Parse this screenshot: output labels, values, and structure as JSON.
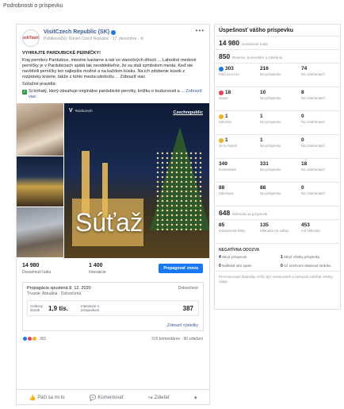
{
  "page": {
    "title": "Podrobnosti o príspevku"
  },
  "post": {
    "avatar_text": "CzechTourism",
    "page_name": "VisitCzech Republic (SK)",
    "meta": "Publikoval(a): Daniel Czech Republic · 17. decembra · ⚙",
    "more": "•••",
    "heading": "VYHRAJTE PARDUBICKÉ PERNÍČKY!",
    "body": "Kraj pernikov Pardubice, miestne kaviarne a tak vo vianočných dňoch ... Lahodné medové perníčky je v Pardubiciach spätá tak neoddeliteľne, že sa stali symbolom mesta. Keď ste navštívili perníčky len najlepšie možné a na každom kúsku. Na ich zdobenie kúsok z rozprávky krásne, takže z tohto mesta udobrotu ... Zobraziť viac",
    "see_more": "Zobraziť viac",
    "rules_label": "Súťažné pravidlá:",
    "contest_text": "Si bohatý, ktorý obsahuje originálne pardubické perníky, knižku o buducnosti a ...",
    "contest_link": "Zobraziť viac",
    "media": {
      "logo_text": "V",
      "logo_sub": "#visitczech",
      "brand_right": "Czechrepublic",
      "overlay": "Súťaž"
    },
    "stats": [
      {
        "value": "14 980",
        "label": "Dosiahnutí ľudia"
      },
      {
        "value": "1 400",
        "label": "Interakcie"
      }
    ],
    "boost_label": "Propagovať znova",
    "ad": {
      "title": "Propagácia spustená 8. 12. 2020",
      "subtitle": "Trvanie: Aktuálna · Dokončená",
      "status": "Dokončené",
      "metrics": [
        {
          "label": "Celkový dosah",
          "value": "1,9 tis."
        },
        {
          "label": "Interakcie s príspevkom",
          "value": "387"
        }
      ],
      "link": "Zobraziť výsledky"
    },
    "reactions": {
      "count": "301",
      "comments": "315 komentárov · 90 zdieľaní"
    },
    "actions": [
      {
        "icon": "👍",
        "label": "Páči sa mi to"
      },
      {
        "icon": "💬",
        "label": "Komentovať"
      },
      {
        "icon": "↪",
        "label": "Zdieľať"
      },
      {
        "icon": "▾",
        "label": ""
      }
    ]
  },
  "performance": {
    "title": "Úspešnosť vášho príspevku",
    "reach": {
      "value": "14 980",
      "label": "Dosiahnutí ľudia"
    },
    "engagement": {
      "value": "850",
      "label": "Reakcie, komentáre a zdieľania"
    },
    "reaction_rows": [
      [
        {
          "value": "303",
          "label": "Páči sa mi to",
          "emoji": "like"
        },
        {
          "value": "216",
          "label": "Na príspevku"
        },
        {
          "value": "74",
          "label": "Na zdieľaniach"
        }
      ],
      [
        {
          "value": "18",
          "label": "Super",
          "emoji": "love"
        },
        {
          "value": "10",
          "label": "Na príspevku"
        },
        {
          "value": "8",
          "label": "Na zdieľaniach"
        }
      ],
      [
        {
          "value": "1",
          "label": "Zdvorilo",
          "emoji": "wow"
        },
        {
          "value": "1",
          "label": "Na príspevku"
        },
        {
          "value": "0",
          "label": "Na zdieľaniach"
        }
      ],
      [
        {
          "value": "1",
          "label": "Je to vtipné",
          "emoji": "wow"
        },
        {
          "value": "1",
          "label": "Na príspevku"
        },
        {
          "value": "0",
          "label": "Na zdieľaniach"
        }
      ],
      [
        {
          "value": "349",
          "label": "Komentáre"
        },
        {
          "value": "331",
          "label": "Na príspevku"
        },
        {
          "value": "18",
          "label": "Na zdieľaniach"
        }
      ],
      [
        {
          "value": "88",
          "label": "Zdieľania"
        },
        {
          "value": "88",
          "label": "Na príspevku"
        },
        {
          "value": "0",
          "label": "Na zdieľaniach"
        }
      ]
    ],
    "clicks": {
      "value": "648",
      "label": "Kliknutia na príspevok"
    },
    "click_row": [
      {
        "value": "85",
        "label": "Zobrazenia fotky"
      },
      {
        "value": "135",
        "label": "Kliknutia na odkaz"
      },
      {
        "value": "453",
        "label": "Iné kliknutia"
      }
    ],
    "negative_title": "NEGATÍVNA ODOZVA",
    "negative": [
      {
        "value": "4",
        "label": "Skryť príspevok"
      },
      {
        "value": "1",
        "label": "Skryť všetky príspevky"
      },
      {
        "value": "0",
        "label": "Nahlásiť ako spam"
      },
      {
        "value": "0",
        "label": "Už nechcem sledovať stránku"
      }
    ],
    "note": "Prezentované štatistiky môžu byť oneskorené a nemusia zahŕňať všetky údaje."
  }
}
